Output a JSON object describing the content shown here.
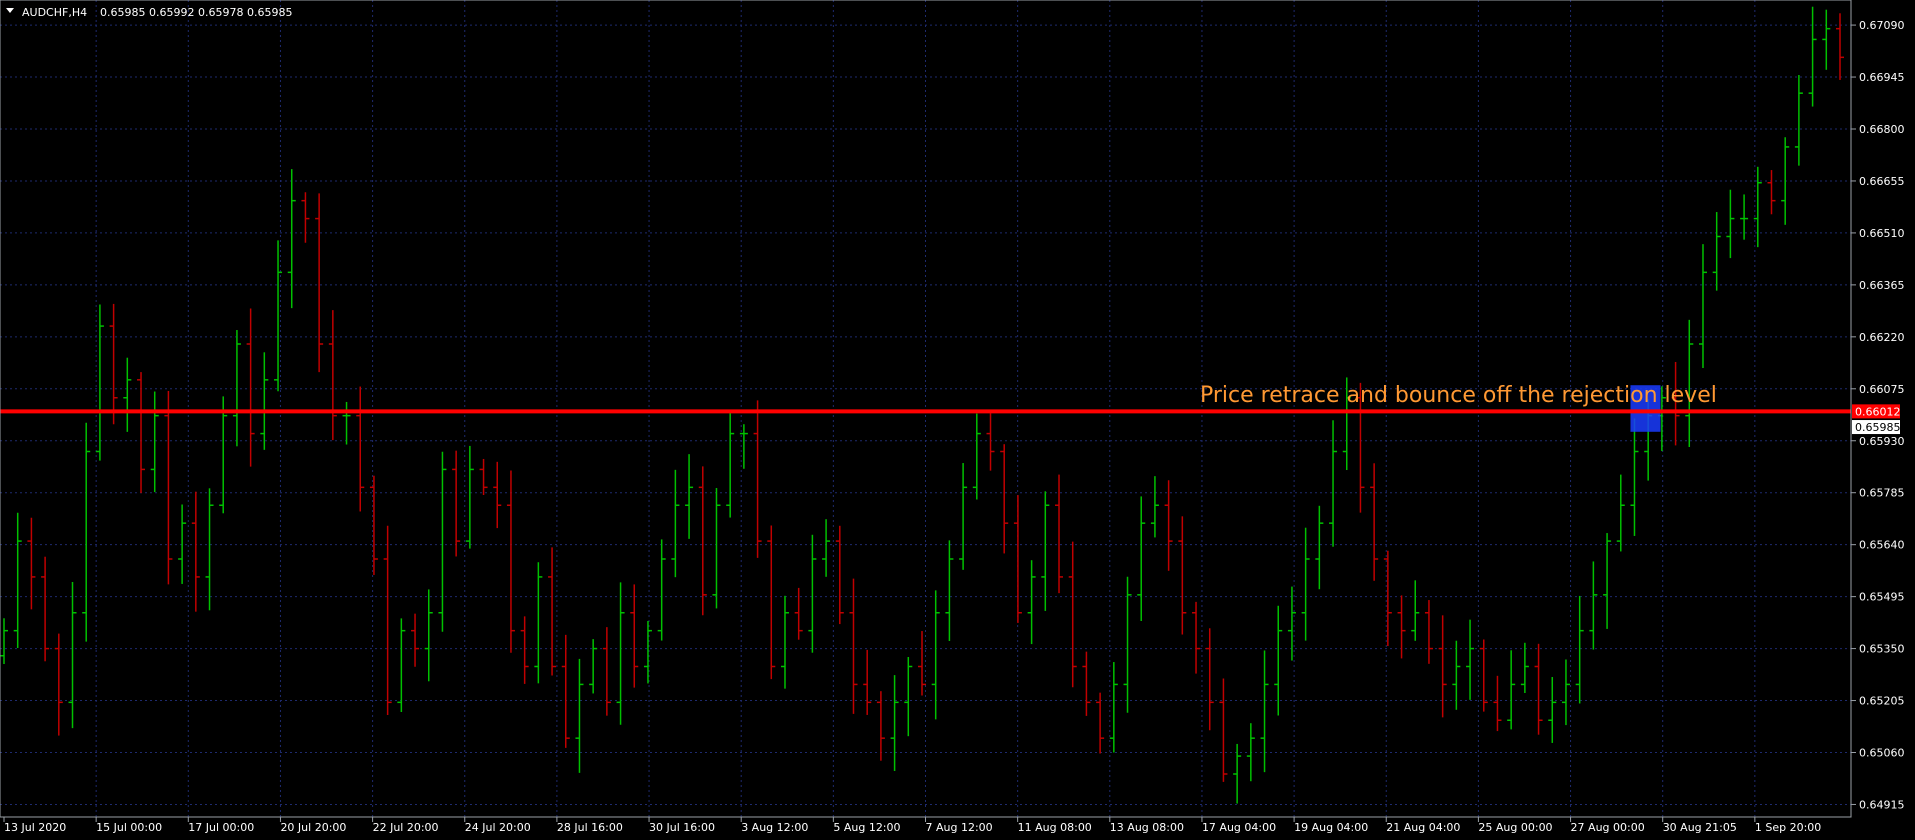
{
  "header": {
    "symbol_timeframe": "AUDCHF,H4",
    "ohlc": "0.65985 0.65992 0.65978 0.65985"
  },
  "annotation": {
    "text": "Price retrace and bounce off the rejection level"
  },
  "colors": {
    "background": "#000000",
    "grid": "#1e2a6e",
    "bull": "#00c000",
    "bear": "#c00000",
    "level_line": "#ff0000",
    "annotation_text": "#ff9933",
    "highlight": "#1a3cff",
    "axis_text": "#ffffff"
  },
  "chart_data": {
    "type": "ohlc",
    "y_ticks": [
      "0.67090",
      "0.66945",
      "0.66800",
      "0.66655",
      "0.66510",
      "0.66365",
      "0.66220",
      "0.66075",
      "0.65930",
      "0.65785",
      "0.65640",
      "0.65495",
      "0.65350",
      "0.65205",
      "0.65060",
      "0.64915"
    ],
    "y_tick_values": [
      0.6709,
      0.66945,
      0.668,
      0.66655,
      0.6651,
      0.66365,
      0.6622,
      0.66075,
      0.6593,
      0.65785,
      0.6564,
      0.65495,
      0.6535,
      0.65205,
      0.6506,
      0.64915
    ],
    "x_ticks": [
      "13 Jul 2020",
      "15 Jul 00:00",
      "17 Jul 00:00",
      "20 Jul 20:00",
      "22 Jul 20:00",
      "24 Jul 20:00",
      "28 Jul 16:00",
      "30 Jul 16:00",
      "3 Aug 12:00",
      "5 Aug 12:00",
      "7 Aug 12:00",
      "11 Aug 08:00",
      "13 Aug 08:00",
      "17 Aug 04:00",
      "19 Aug 04:00",
      "21 Aug 04:00",
      "25 Aug 00:00",
      "27 Aug 00:00",
      "30 Aug 21:05",
      "1 Sep 20:00"
    ],
    "ylim": [
      0.6488,
      0.6716
    ],
    "level": {
      "value": 0.66012,
      "label": "0.66012"
    },
    "current": {
      "value": 0.65985,
      "label": "0.65985"
    },
    "grid": true,
    "bars_close": [
      0.654,
      0.6565,
      0.6555,
      0.6535,
      0.652,
      0.6545,
      0.659,
      0.6625,
      0.6605,
      0.661,
      0.6585,
      0.66,
      0.656,
      0.657,
      0.6555,
      0.6575,
      0.66,
      0.662,
      0.6595,
      0.661,
      0.664,
      0.666,
      0.6655,
      0.662,
      0.66,
      0.66,
      0.658,
      0.656,
      0.652,
      0.654,
      0.6535,
      0.6545,
      0.6585,
      0.6565,
      0.6585,
      0.658,
      0.6575,
      0.654,
      0.653,
      0.6555,
      0.653,
      0.651,
      0.6525,
      0.6535,
      0.652,
      0.6545,
      0.653,
      0.654,
      0.656,
      0.6575,
      0.658,
      0.655,
      0.6575,
      0.6595,
      0.6595,
      0.6565,
      0.653,
      0.6545,
      0.654,
      0.656,
      0.6565,
      0.6545,
      0.6525,
      0.652,
      0.651,
      0.652,
      0.653,
      0.6525,
      0.6545,
      0.656,
      0.658,
      0.6595,
      0.659,
      0.657,
      0.6545,
      0.6555,
      0.6575,
      0.6555,
      0.653,
      0.652,
      0.651,
      0.6525,
      0.655,
      0.657,
      0.6575,
      0.6565,
      0.6545,
      0.6535,
      0.652,
      0.65,
      0.6505,
      0.651,
      0.6525,
      0.654,
      0.6545,
      0.656,
      0.657,
      0.659,
      0.6605,
      0.658,
      0.656,
      0.6545,
      0.654,
      0.6545,
      0.6535,
      0.6525,
      0.653,
      0.6535,
      0.652,
      0.6515,
      0.6525,
      0.653,
      0.6515,
      0.652,
      0.6525,
      0.654,
      0.655,
      0.6565,
      0.6575,
      0.659,
      0.66,
      0.6605,
      0.66,
      0.662,
      0.664,
      0.665,
      0.6655,
      0.6655,
      0.6665,
      0.666,
      0.6675,
      0.669,
      0.6705,
      0.6708,
      0.67
    ]
  }
}
